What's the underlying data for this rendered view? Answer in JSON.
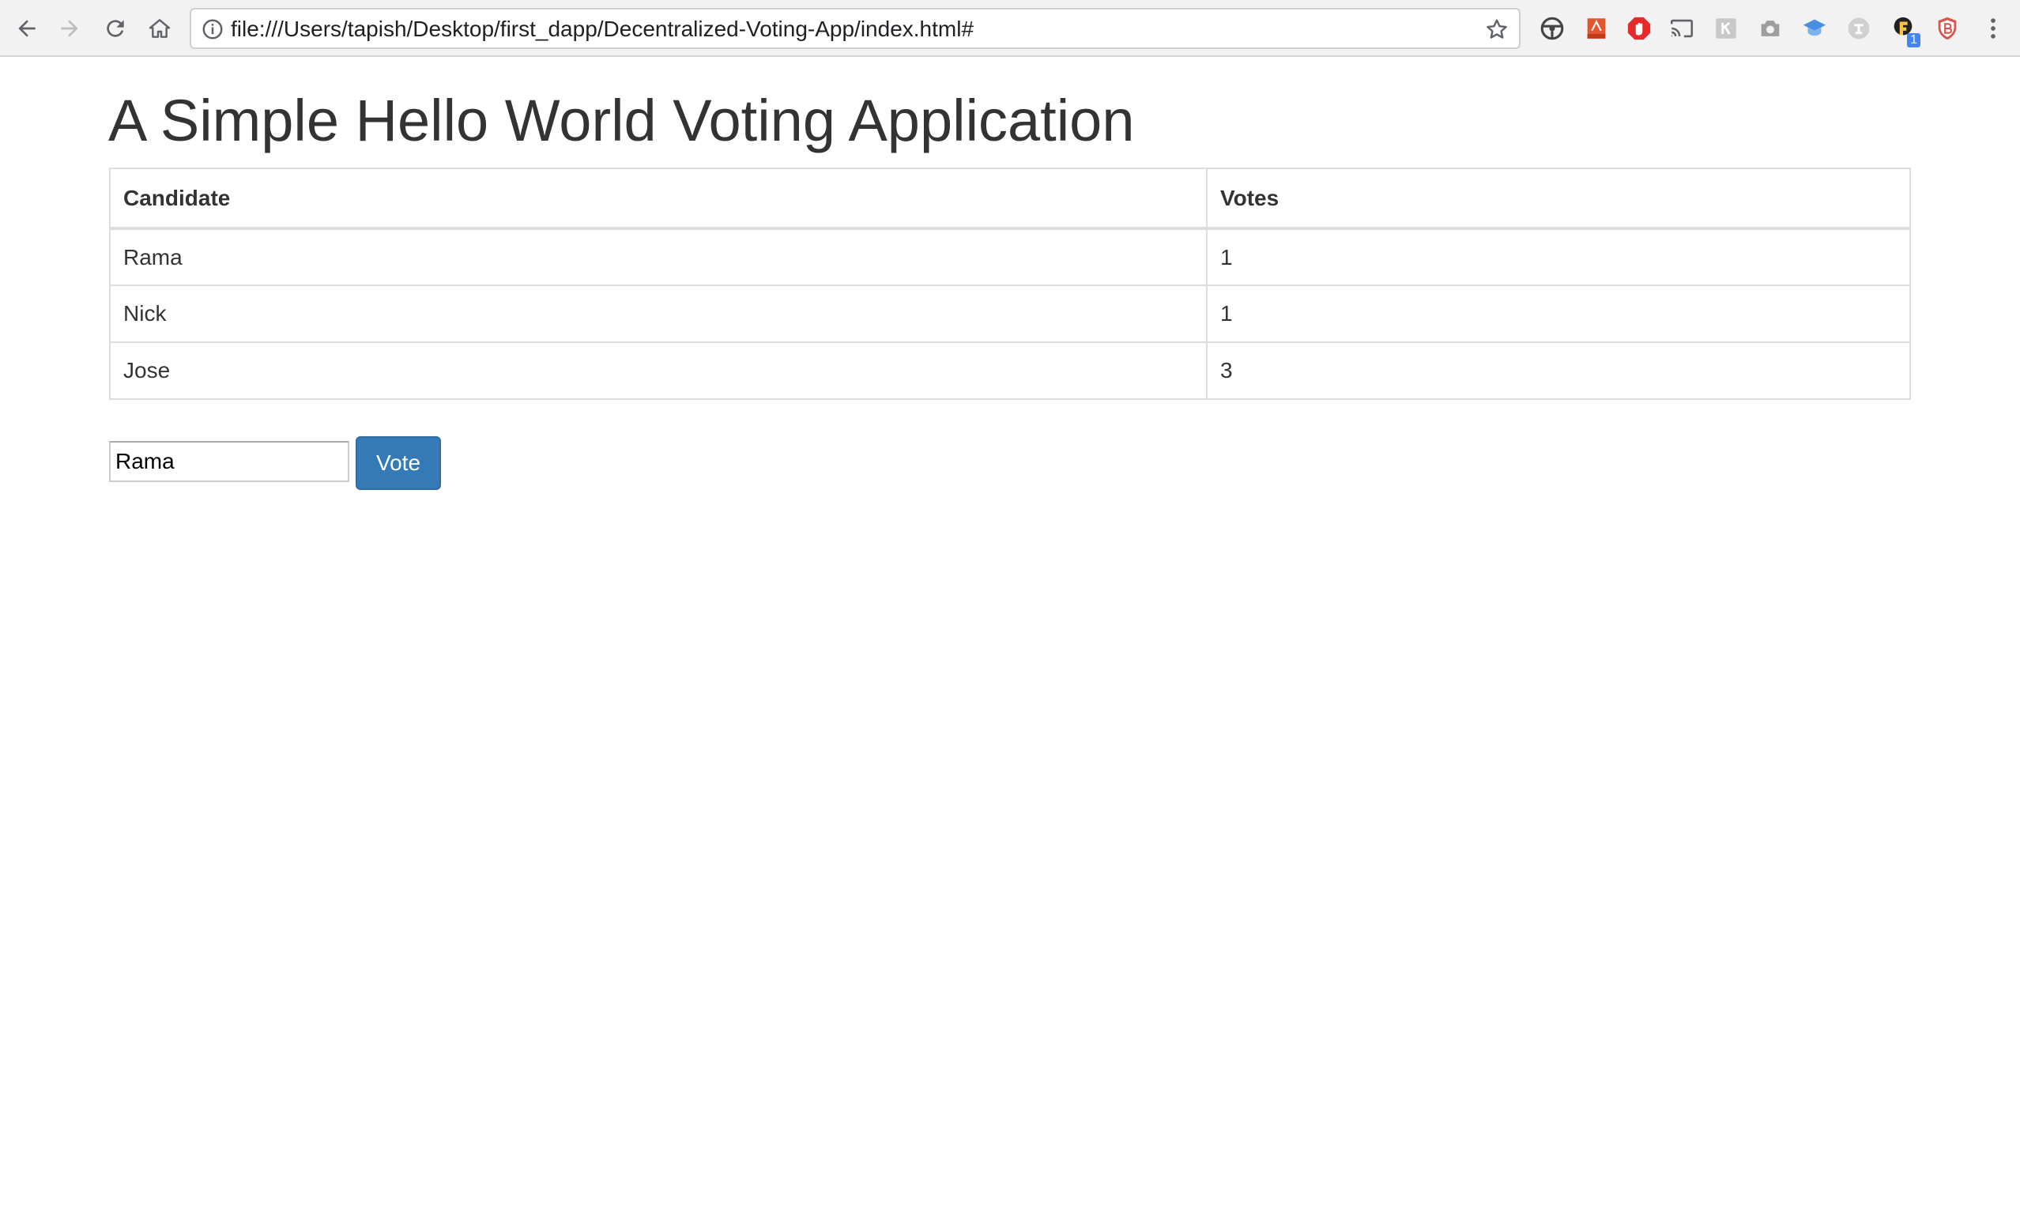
{
  "browser": {
    "url": "file:///Users/tapish/Desktop/first_dapp/Decentralized-Voting-App/index.html#",
    "extension_badge": "1",
    "icons": [
      "back-arrow-icon",
      "forward-arrow-icon",
      "reload-icon",
      "home-icon",
      "info-icon",
      "bookmark-star-icon",
      "chrome-menu-icon"
    ]
  },
  "page": {
    "title": "A Simple Hello World Voting Application",
    "table": {
      "headers": [
        "Candidate",
        "Votes"
      ],
      "rows": [
        {
          "candidate": "Rama",
          "votes": "1"
        },
        {
          "candidate": "Nick",
          "votes": "1"
        },
        {
          "candidate": "Jose",
          "votes": "3"
        }
      ]
    },
    "input_value": "Rama",
    "vote_label": "Vote"
  },
  "colors": {
    "vote_button": "#337ab7",
    "text": "#333333",
    "table_border": "#dddddd"
  }
}
